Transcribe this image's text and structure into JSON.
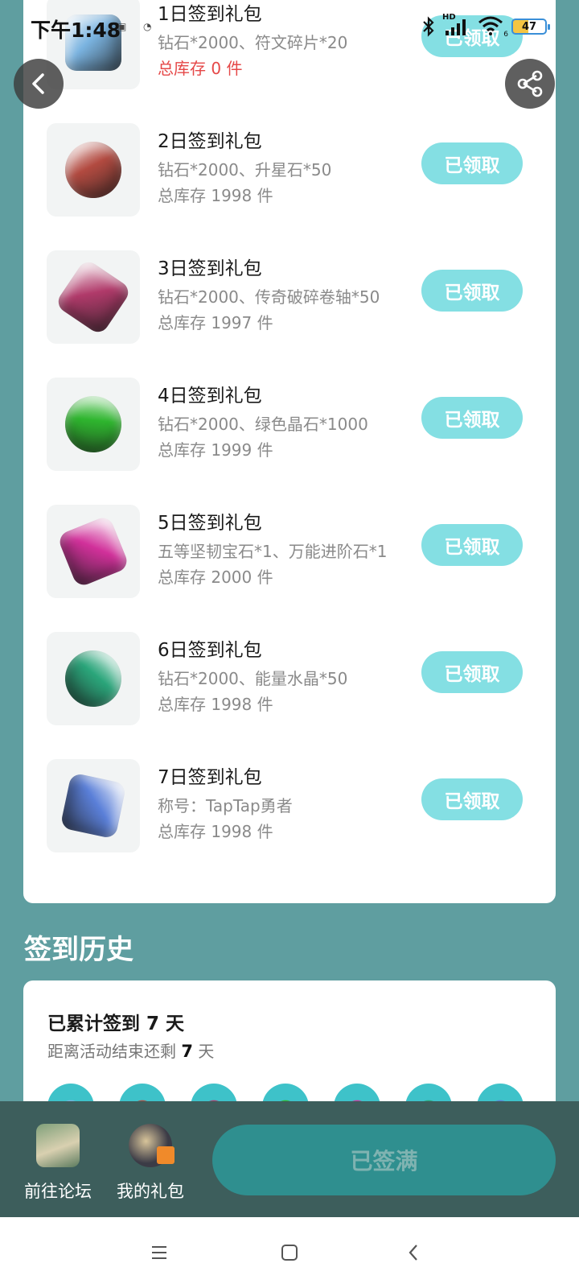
{
  "status_bar": {
    "time": "下午1:48",
    "battery": "47",
    "network": "HD",
    "wifi_sub": "6"
  },
  "gifts": [
    {
      "title": "1日签到礼包",
      "desc": "钻石*2000、符文碎片*20",
      "stock": "总库存 0 件",
      "button": "已领取",
      "icon": "blue-crystal-icon",
      "color": "#7ab3e0"
    },
    {
      "title": "2日签到礼包",
      "desc": "钻石*2000、升星石*50",
      "stock": "总库存 1998 件",
      "button": "已领取",
      "icon": "red-star-stone-icon",
      "color": "#b24a40"
    },
    {
      "title": "3日签到礼包",
      "desc": "钻石*2000、传奇破碎卷轴*50",
      "stock": "总库存 1997 件",
      "button": "已领取",
      "icon": "scroll-icon",
      "color": "#b03a6a"
    },
    {
      "title": "4日签到礼包",
      "desc": "钻石*2000、绿色晶石*1000",
      "stock": "总库存 1999 件",
      "button": "已领取",
      "icon": "green-crystal-icon",
      "color": "#2eb52e"
    },
    {
      "title": "5日签到礼包",
      "desc": "五等坚韧宝石*1、万能进阶石*1",
      "stock": "总库存 2000 件",
      "button": "已领取",
      "icon": "pink-gem-icon",
      "color": "#d1309a"
    },
    {
      "title": "6日签到礼包",
      "desc": "钻石*2000、能量水晶*50",
      "stock": "总库存 1998 件",
      "button": "已领取",
      "icon": "potion-bottle-icon",
      "color": "#2aa57a"
    },
    {
      "title": "7日签到礼包",
      "desc": "称号：TapTap勇者",
      "stock": "总库存 1998 件",
      "button": "已领取",
      "icon": "title-badge-icon",
      "color": "#5a7fd8"
    }
  ],
  "history": {
    "heading": "签到历史",
    "count_prefix": "已累计签到",
    "count_value": "7",
    "count_suffix": "天",
    "remaining_prefix": "距离活动结束还剩",
    "remaining_value": "7",
    "remaining_suffix": "天"
  },
  "bottom_bar": {
    "forum_label": "前往论坛",
    "my_gifts_label": "我的礼包",
    "signed_full_label": "已签满"
  },
  "colors": {
    "background": "#5f9ea0",
    "claim_button": "#84dfe3",
    "bottom_bar": "#3d5e5c",
    "signed_button": "#2f8f8f",
    "stock_empty": "#e54848"
  }
}
